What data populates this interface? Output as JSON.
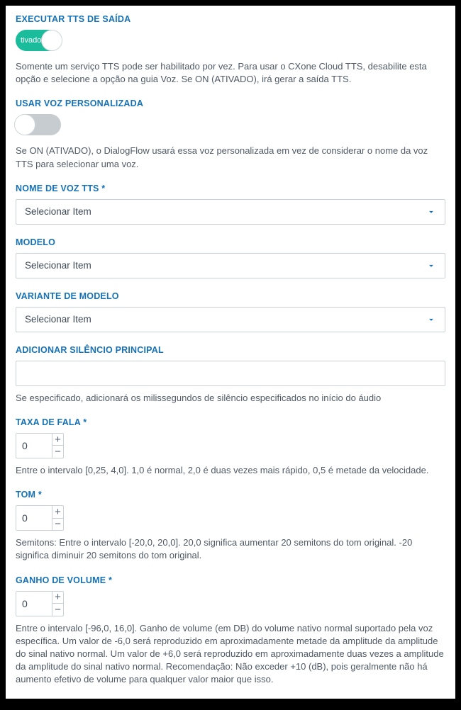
{
  "executeTts": {
    "label": "EXECUTAR TTS DE SAÍDA",
    "toggleState": "on",
    "toggleText": "tivado",
    "help": "Somente um serviço TTS pode ser habilitado por vez. Para usar o CXone Cloud TTS, desabilite esta opção e selecione a opção na guia Voz. Se ON (ATIVADO), irá gerar a saída TTS."
  },
  "customVoice": {
    "label": "USAR VOZ PERSONALIZADA",
    "toggleState": "off",
    "toggleText": "",
    "help": "Se ON (ATIVADO), o DialogFlow usará essa voz personalizada em vez de considerar o nome da voz TTS para selecionar uma voz."
  },
  "voiceName": {
    "label": "NOME DE VOZ TTS *",
    "selected": "Selecionar Item"
  },
  "model": {
    "label": "MODELO",
    "selected": "Selecionar Item"
  },
  "modelVariant": {
    "label": "VARIANTE DE MODELO",
    "selected": "Selecionar Item"
  },
  "leadingSilence": {
    "label": "ADICIONAR SILÊNCIO PRINCIPAL",
    "value": "",
    "help": "Se especificado, adicionará os milissegundos de silêncio especificados no início do áudio"
  },
  "speechRate": {
    "label": "TAXA DE FALA *",
    "value": "0",
    "help": "Entre o intervalo [0,25, 4,0]. 1,0 é normal, 2,0 é duas vezes mais rápido, 0,5 é metade da velocidade."
  },
  "pitch": {
    "label": "TOM *",
    "value": "0",
    "help": "Semitons: Entre o intervalo [-20,0, 20,0]. 20,0 significa aumentar 20 semitons do tom original. -20 significa diminuir 20 semitons do tom original."
  },
  "volumeGain": {
    "label": "GANHO DE VOLUME *",
    "value": "0",
    "help": "Entre o intervalo [-96,0, 16,0]. Ganho de volume (em DB) do volume nativo normal suportado pela voz específica. Um valor de -6,0 será reproduzido em aproximadamente metade da amplitude da amplitude do sinal nativo normal. Um valor de +6,0 será reproduzido em aproximadamente duas vezes a amplitude da amplitude do sinal nativo normal. Recomendação: Não exceder +10 (dB), pois geralmente não há aumento efetivo de volume para qualquer valor maior que isso."
  }
}
